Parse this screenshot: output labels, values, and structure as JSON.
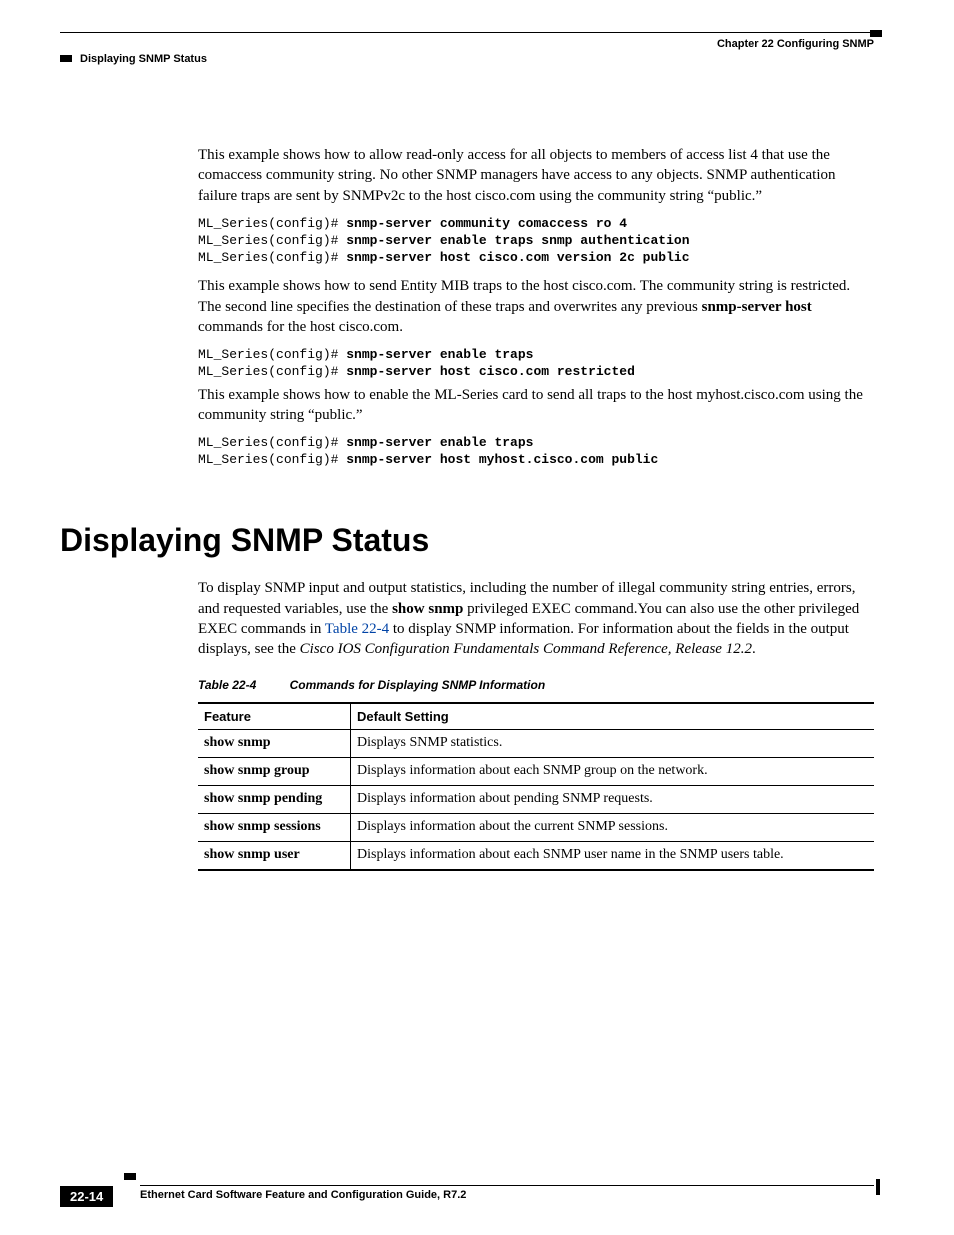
{
  "header": {
    "chapter": "Chapter 22    Configuring SNMP",
    "section": "Displaying SNMP Status"
  },
  "body": {
    "p1": "This example shows how to allow read-only access for all objects to members of access list 4 that use the comaccess community string. No other SNMP managers have access to any objects. SNMP authentication failure traps are sent by SNMPv2c to the host cisco.com using the community string “public.”",
    "code1_line1_prompt": "ML_Series(config)# ",
    "code1_line1_cmd": "snmp-server community comaccess ro 4",
    "code1_line2_prompt": "ML_Series(config)# ",
    "code1_line2_cmd": "snmp-server enable traps snmp authentication",
    "code1_line3_prompt": "ML_Series(config)# ",
    "code1_line3_cmd": "snmp-server host cisco.com version 2c public",
    "p2_pre": "This example shows how to send Entity MIB traps to the host cisco.com. The community string is restricted. The second line specifies the destination of these traps and overwrites any previous ",
    "p2_bold": "snmp-server host",
    "p2_post": " commands for the host cisco.com.",
    "code2_line1_prompt": "ML_Series(config)# ",
    "code2_line1_cmd": "snmp-server enable traps",
    "code2_line2_prompt": "ML_Series(config)# ",
    "code2_line2_cmd": "snmp-server host cisco.com restricted",
    "p3": "This example shows how to enable the ML-Series card to send all traps to the host myhost.cisco.com using the community string “public.”",
    "code3_line1_prompt": "ML_Series(config)# ",
    "code3_line1_cmd": "snmp-server enable traps",
    "code3_line2_prompt": "ML_Series(config)# ",
    "code3_line2_cmd": "snmp-server host myhost.cisco.com public",
    "heading": "Displaying SNMP Status",
    "p4_pre": "To display SNMP input and output statistics, including the number of illegal community string entries, errors, and requested variables, use the ",
    "p4_bold": "show snmp",
    "p4_mid": " privileged EXEC command.You can also use the other privileged EXEC commands in ",
    "p4_ref": "Table 22-4",
    "p4_post": " to display SNMP information. For information about the fields in the output displays, see the ",
    "p4_italic": "Cisco IOS Configuration Fundamentals Command Reference, Release 12.2",
    "p4_end": ".",
    "table_label": "Table 22-4",
    "table_title": "Commands for Displaying SNMP Information",
    "th1": "Feature",
    "th2": "Default Setting",
    "rows": [
      {
        "feature": "show snmp",
        "desc": "Displays SNMP statistics."
      },
      {
        "feature": "show snmp group",
        "desc": "Displays information about each SNMP group on the network."
      },
      {
        "feature": "show snmp pending",
        "desc": "Displays information about pending SNMP requests."
      },
      {
        "feature": "show snmp sessions",
        "desc": "Displays information about the current SNMP sessions."
      },
      {
        "feature": "show snmp user",
        "desc": "Displays information about each SNMP user name in the SNMP users table."
      }
    ]
  },
  "footer": {
    "title": "Ethernet Card Software Feature and Configuration Guide, R7.2",
    "page": "22-14"
  }
}
